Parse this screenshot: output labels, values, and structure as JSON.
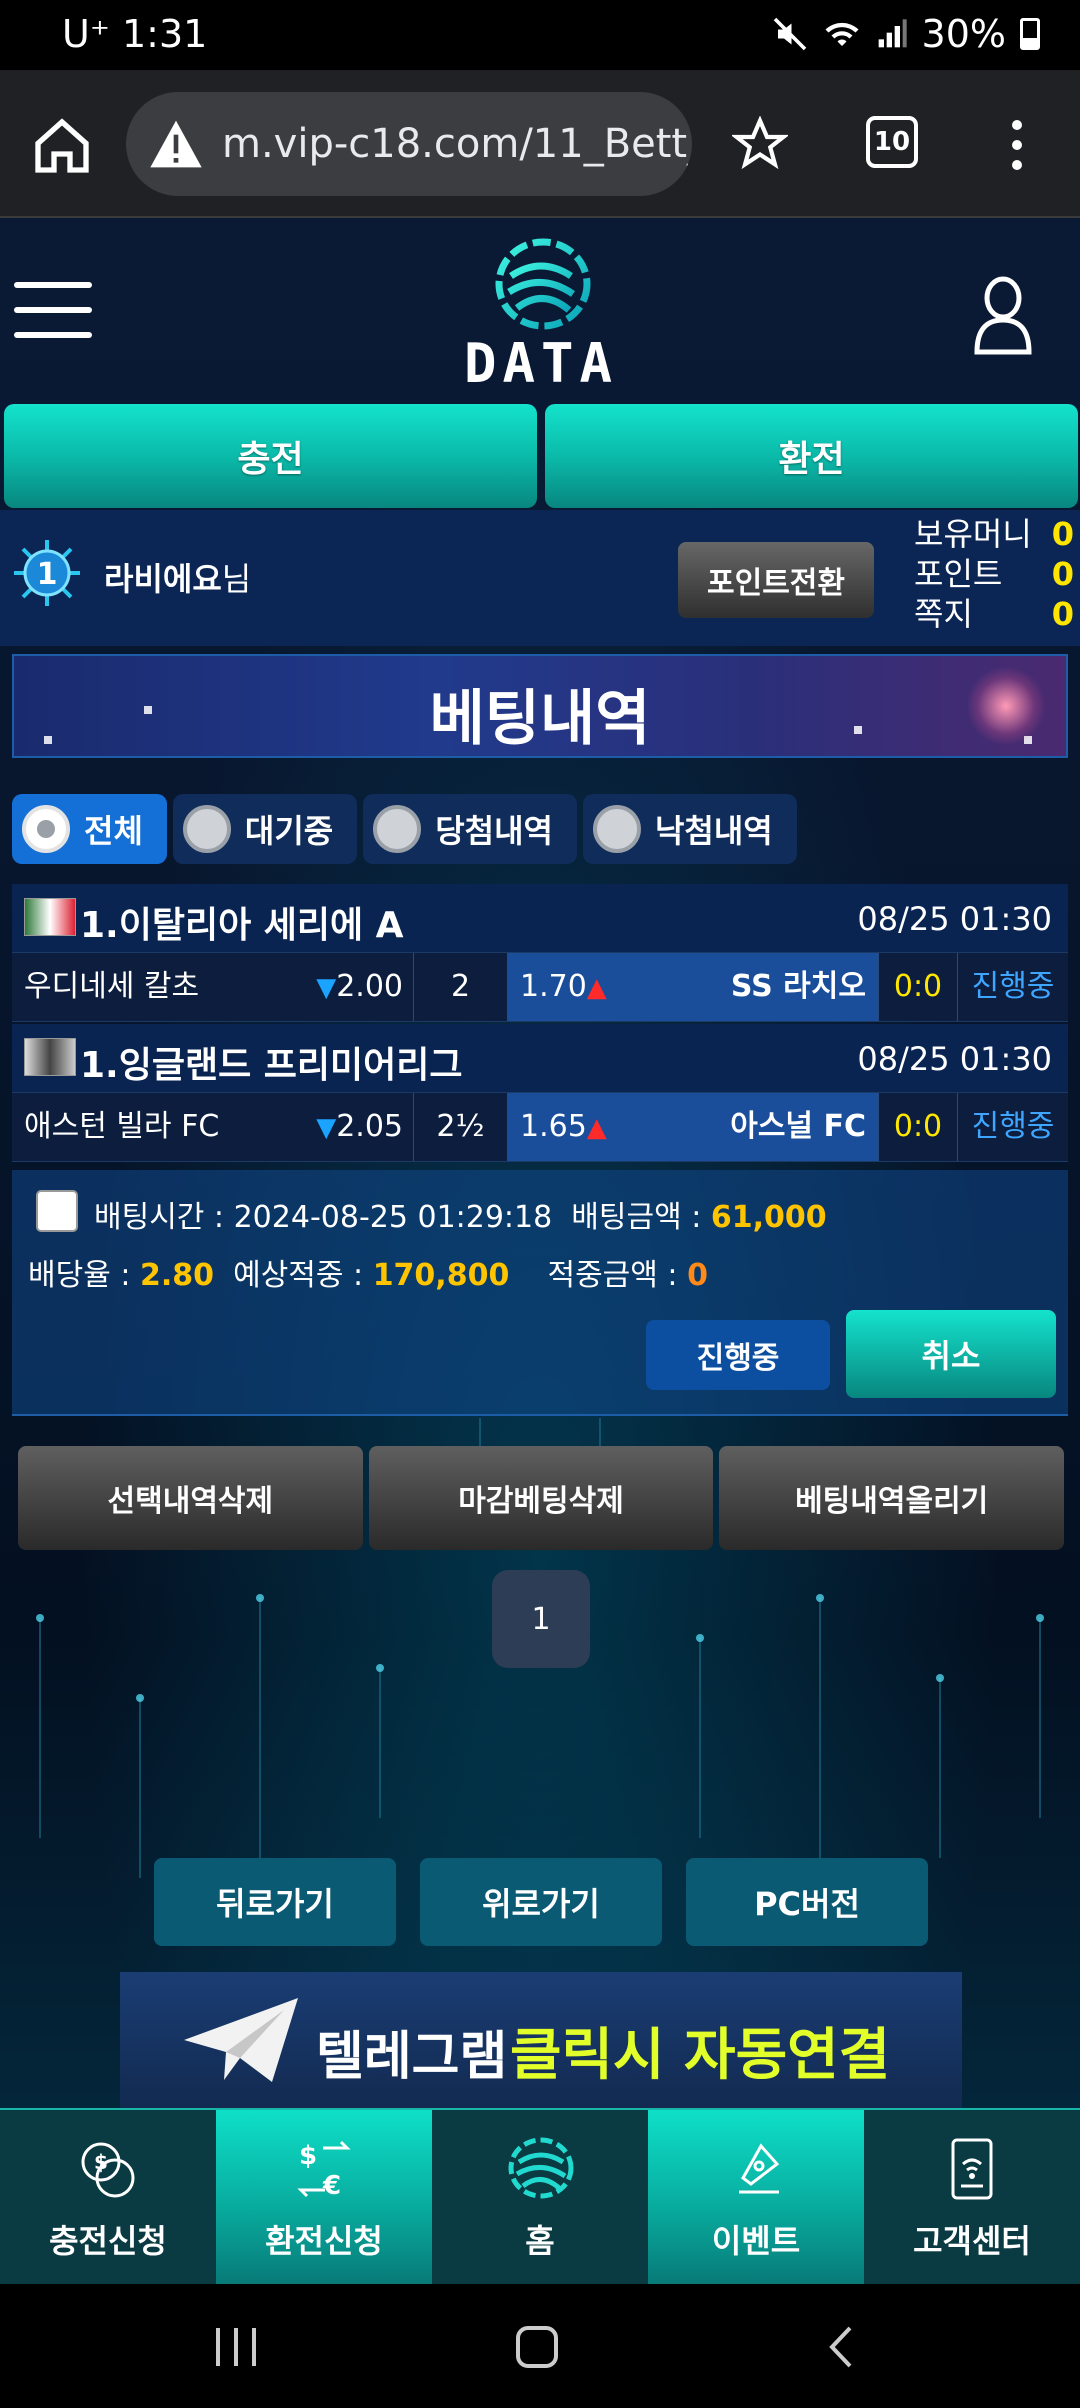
{
  "status_bar": {
    "carrier": "U⁺",
    "time": "1:31",
    "battery": "30%"
  },
  "browser": {
    "url": "m.vip-c18.com/11_Bett_l",
    "tab_count": "10"
  },
  "header": {
    "logo_text": "DATA"
  },
  "top_buttons": {
    "charge": "충전",
    "exchange": "환전"
  },
  "user": {
    "level": "1",
    "name": "라비에요",
    "suffix": "님",
    "point_convert": "포인트전환"
  },
  "stats": [
    {
      "label": "보유머니",
      "value": "0"
    },
    {
      "label": "포인트",
      "value": "0"
    },
    {
      "label": "쪽지",
      "value": "0"
    }
  ],
  "banner": {
    "title": "베팅내역"
  },
  "filters": [
    "전체",
    "대기중",
    "당첨내역",
    "낙첨내역"
  ],
  "bets": [
    {
      "league": "1.이탈리아 세리에 A",
      "date": "08/25 01:30",
      "home": "우디네세 칼초",
      "home_odds": "2.00",
      "draw": "2",
      "away_odds": "1.70",
      "away": "SS 라치오",
      "score": "0:0",
      "status": "진행중"
    },
    {
      "league": "1.잉글랜드 프리미어리그",
      "date": "08/25 01:30",
      "home": "애스턴 빌라 FC",
      "home_odds": "2.05",
      "draw": "2½",
      "away_odds": "1.65",
      "away": "아스널 FC",
      "score": "0:0",
      "status": "진행중"
    }
  ],
  "slip": {
    "time_label": "배팅시간 : ",
    "time": "2024-08-25 01:29:18",
    "amount_label": "배팅금액 : ",
    "amount": "61,000",
    "odds_label": "배당율 : ",
    "odds": "2.80",
    "expected_label": "예상적중 : ",
    "expected": "170,800",
    "won_label": "적중금액 : ",
    "won": "0",
    "status_btn": "진행중",
    "cancel_btn": "취소"
  },
  "actions": [
    "선택내역삭제",
    "마감베팅삭제",
    "베팅내역올리기"
  ],
  "pagination": {
    "current": "1"
  },
  "nav_buttons": [
    "뒤로가기",
    "위로가기",
    "PC버전"
  ],
  "telegram": {
    "text1": "텔레그램",
    "text2": "클릭시 자동연결"
  },
  "bottom_nav": [
    "충전신청",
    "환전신청",
    "홈",
    "이벤트",
    "고객센터"
  ]
}
